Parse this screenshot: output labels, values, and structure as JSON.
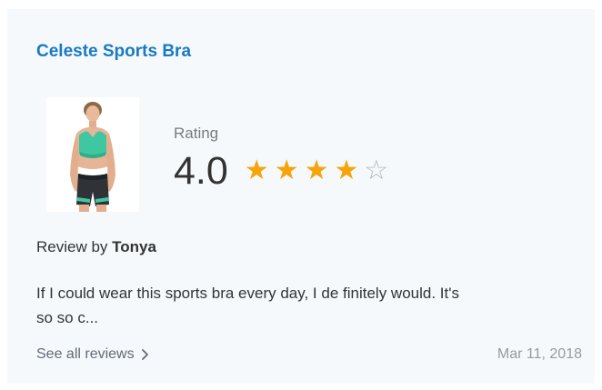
{
  "product": {
    "name": "Celeste Sports Bra",
    "image_alt": "product-photo"
  },
  "rating": {
    "label": "Rating",
    "value": "4.0",
    "score": 4,
    "max": 5,
    "star_full": "★",
    "star_empty": "☆",
    "colors": {
      "star_full": "#f7a30a",
      "star_empty": "#b8b8b8"
    }
  },
  "review": {
    "by_prefix": "Review by ",
    "author": "Tonya",
    "text": "If I could wear this sports bra every day, I de finitely would. It's so so c...",
    "date": "Mar 11, 2018"
  },
  "links": {
    "see_all": "See all reviews",
    "see_all_icon": "chevron-right-icon"
  },
  "colors": {
    "card_bg": "#f5f9fc",
    "title": "#1979c3"
  }
}
